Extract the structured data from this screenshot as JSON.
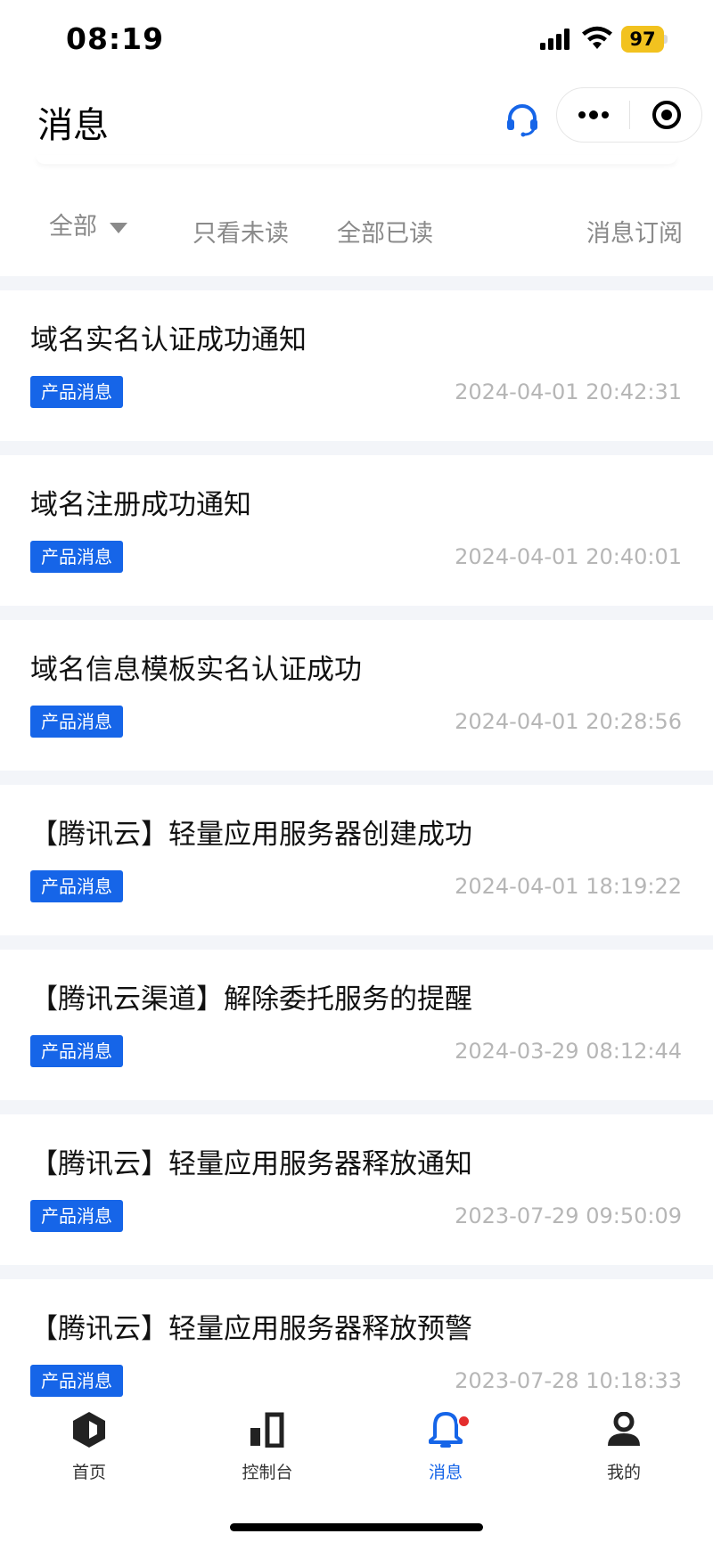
{
  "status_bar": {
    "time": "08:19",
    "battery": "97",
    "signal_icon": "signal-bars-icon",
    "wifi_icon": "wifi-icon"
  },
  "nav": {
    "title": "消息",
    "support_icon": "headset-icon",
    "more_icon": "more-dots-icon",
    "close_icon": "target-icon"
  },
  "filters": {
    "all": "全部",
    "unread": "只看未读",
    "read_all": "全部已读",
    "subscribe": "消息订阅"
  },
  "messages": [
    {
      "title": "域名实名认证成功通知",
      "tag": "产品消息",
      "time": "2024-04-01 20:42:31"
    },
    {
      "title": "域名注册成功通知",
      "tag": "产品消息",
      "time": "2024-04-01 20:40:01"
    },
    {
      "title": "域名信息模板实名认证成功",
      "tag": "产品消息",
      "time": "2024-04-01 20:28:56"
    },
    {
      "title": "【腾讯云】轻量应用服务器创建成功",
      "tag": "产品消息",
      "time": "2024-04-01 18:19:22"
    },
    {
      "title": "【腾讯云渠道】解除委托服务的提醒",
      "tag": "产品消息",
      "time": "2024-03-29 08:12:44"
    },
    {
      "title": "【腾讯云】轻量应用服务器释放通知",
      "tag": "产品消息",
      "time": "2023-07-29 09:50:09"
    },
    {
      "title": "【腾讯云】轻量应用服务器释放预警",
      "tag": "产品消息",
      "time": "2023-07-28 10:18:33"
    }
  ],
  "tabs": [
    {
      "label": "首页",
      "icon": "cube-icon"
    },
    {
      "label": "控制台",
      "icon": "bar-chart-icon"
    },
    {
      "label": "消息",
      "icon": "bell-icon"
    },
    {
      "label": "我的",
      "icon": "user-icon"
    }
  ],
  "colors": {
    "accent": "#1665e8",
    "badge": "#e42d2d",
    "battery": "#f2c21f",
    "list_background": "#f3f5f9"
  }
}
